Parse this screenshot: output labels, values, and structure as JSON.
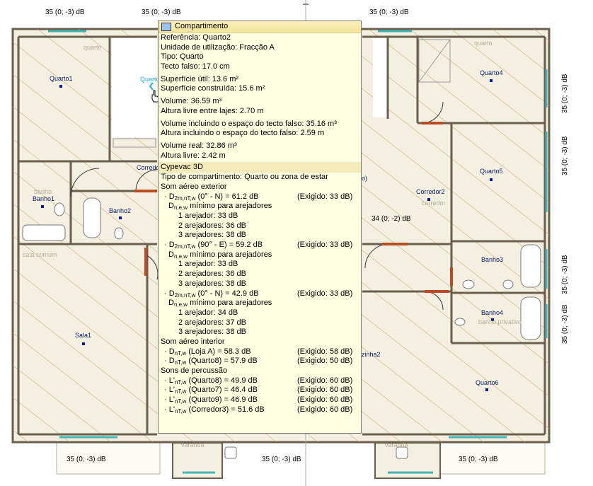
{
  "dimensions_outer": {
    "top_left": "35 (0; -3) dB",
    "top_center": "35 (0; -3) dB",
    "top_right": "35 (0; -3) dB",
    "right_top": "35 (0; -3) dB",
    "right_mid": "35 (0; -3) dB",
    "right_low1": "35 (0; -3) dB",
    "right_low2": "35 (0; -3) dB",
    "bottom_left": "35 (0; -3) dB",
    "bottom_center": "35 (0; -3) dB",
    "bottom_right": "35 (0; -3) dB",
    "interior_right": "34 (0; -2) dB"
  },
  "rooms": {
    "quarto1": "Quarto1",
    "quarto2_partial": "Quarto",
    "quarto4": "Quarto4",
    "quarto5": "Quarto5",
    "quarto6": "Quarto6",
    "corredor_partial": "Corredor",
    "corredor2": "Corredor2",
    "banho1": "Banho1",
    "banho2": "Banho2",
    "banho3": "Banho3",
    "banho4": "Banho4",
    "sala1": "Sala1",
    "cozinha2_partial": "zinha2",
    "paren_partial": "o)"
  },
  "faint_labels": {
    "quarto_a": "quarto",
    "quarto_b": "quarto",
    "sala_comum": "sala comum",
    "banho_a": "banho",
    "corredor": "corredor",
    "banho_privativo": "banho privativo",
    "varanda_a": "varanda",
    "varanda_b": "varanda"
  },
  "tooltip": {
    "title": "Compartimento",
    "referencia": "Referência: Quarto2",
    "unidade": "Unidade de utilização: Fracção A",
    "tipo": "Tipo: Quarto",
    "tecto": "Tecto falso: 17.0 cm",
    "sup_util": "Superfície útil: 13.6 m²",
    "sup_constr": "Superfície construída: 15.6 m²",
    "volume": "Volume: 36.59 m³",
    "altura_lajes": "Altura livre entre lajes: 2.70 m",
    "vol_tecto": "Volume incluindo o espaço do tecto falso: 35.16 m³",
    "alt_tecto": "Altura incluindo o espaço do tecto falso: 2.59 m",
    "vol_real": "Volume real: 32.86 m³",
    "alt_livre": "Altura livre: 2.42 m",
    "section": "Cypevac 3D",
    "tipo_comp": "Tipo de compartimento: Quarto ou zona de estar",
    "som_ext": "Som aéreo exterior",
    "d1": "(0° - N) = 61.2 dB",
    "d1_req": "(Exigido: 33 dB)",
    "dmin_label": "mínimo para arejadores",
    "a1_1": "1 arejador: 33 dB",
    "a1_2": "2 arejadores: 36 dB",
    "a1_3": "3 arejadores: 38 dB",
    "d2": "(90° - E) = 59.2 dB",
    "d2_req": "(Exigido: 33 dB)",
    "a2_1": "1 arejador: 33 dB",
    "a2_2": "2 arejadores: 36 dB",
    "a2_3": "3 arejadores: 38 dB",
    "d3": "(0° - N) = 42.9 dB",
    "d3_req": "(Exigido: 33 dB)",
    "a3_1": "1 arejador: 34 dB",
    "a3_2": "2 arejadores: 37 dB",
    "a3_3": "3 arejadores: 38 dB",
    "som_int": "Som aéreo interior",
    "i1": "(Loja A) = 58.3 dB",
    "i1_req": "(Exigido: 58 dB)",
    "i2": "(Quarto8) = 57.9 dB",
    "i2_req": "(Exigido: 50 dB)",
    "sons_perc": "Sons de percussão",
    "p1": "(Quarto8) = 49.9 dB",
    "p1_req": "(Exigido: 60 dB)",
    "p2": "(Quarto7) = 46.4 dB",
    "p2_req": "(Exigido: 60 dB)",
    "p3": "(Quarto9) = 46.9 dB",
    "p3_req": "(Exigido: 60 dB)",
    "p4": "(Corredor3) = 51.6 dB",
    "p4_req": "(Exigido: 60 dB)"
  },
  "colors": {
    "wall": "#7a6a55",
    "floor": "#f3f0e2",
    "hatch": "#c8a060",
    "window": "#4ab6b6",
    "door": "#c04a20",
    "tooltip_bg": "#ffffe1"
  }
}
